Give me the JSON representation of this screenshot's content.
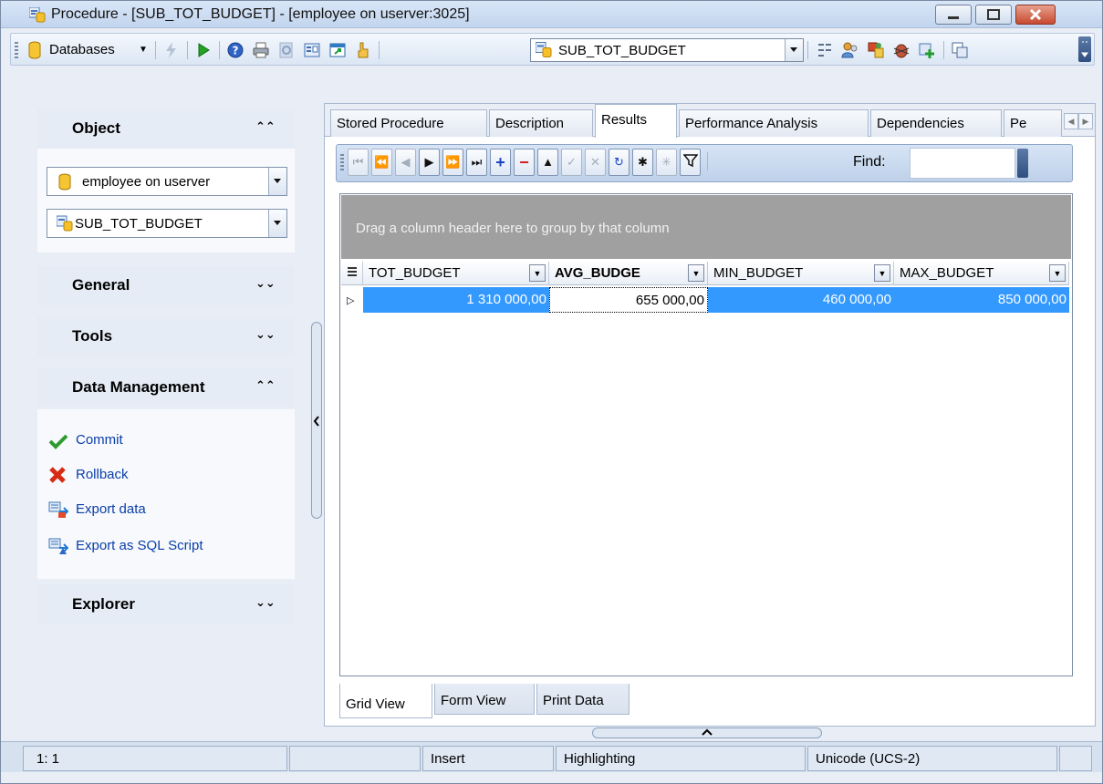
{
  "window": {
    "title": "Procedure - [SUB_TOT_BUDGET] - [employee on userver:3025]"
  },
  "toolbar": {
    "databases_label": "Databases",
    "object_combo_value": "SUB_TOT_BUDGET"
  },
  "nav": {
    "sections": {
      "object": "Object",
      "general": "General",
      "tools": "Tools",
      "data_management": "Data Management",
      "explorer": "Explorer"
    },
    "database_combo_value": "employee on userver",
    "procedure_combo_value": "SUB_TOT_BUDGET",
    "data_links": {
      "commit": "Commit",
      "rollback": "Rollback",
      "export_data": "Export data",
      "export_sql": "Export as SQL Script"
    }
  },
  "tabs": {
    "stored_procedure": "Stored Procedure",
    "description": "Description",
    "results": "Results",
    "performance": "Performance Analysis",
    "dependencies": "Dependencies",
    "truncated": "Pe"
  },
  "navigator": {
    "find_label": "Find:",
    "find_value": ""
  },
  "grid": {
    "group_hint": "Drag a column header here to group by that column",
    "columns": [
      "TOT_BUDGET",
      "AVG_BUDGE",
      "MIN_BUDGET",
      "MAX_BUDGET"
    ],
    "rows": [
      [
        "1 310 000,00",
        "655 000,00",
        "460 000,00",
        "850 000,00"
      ]
    ]
  },
  "view_tabs": {
    "grid_view": "Grid View",
    "form_view": "Form View",
    "print_data": "Print Data"
  },
  "status": {
    "position": "1:   1",
    "empty1": "",
    "mode": "Insert",
    "highlighting": "Highlighting",
    "encoding": "Unicode (UCS-2)"
  },
  "colors": {
    "selection": "#3399ff",
    "link": "#0a3ea8",
    "group_box": "#a0a0a0"
  }
}
